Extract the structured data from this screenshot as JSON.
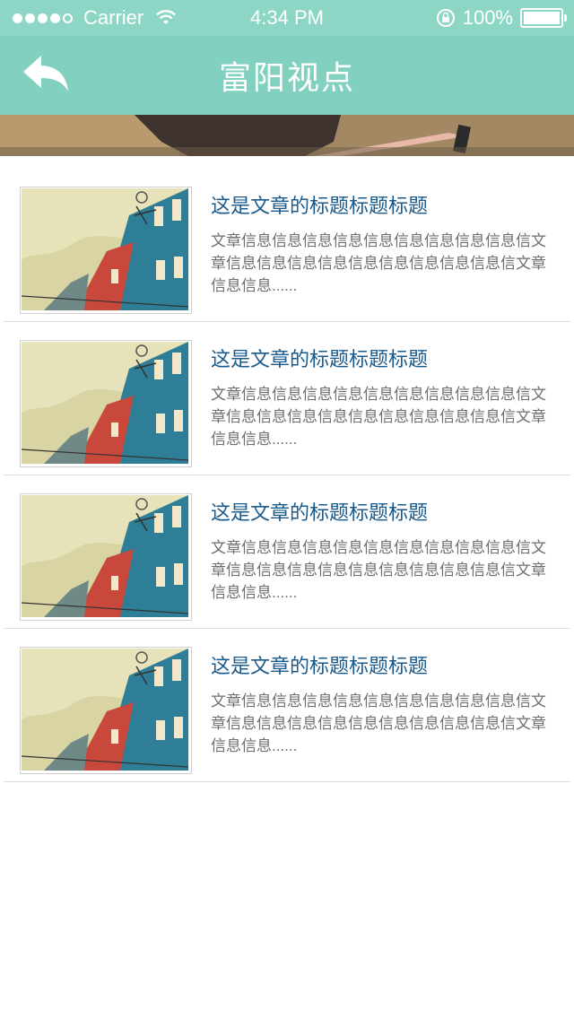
{
  "status_bar": {
    "carrier": "Carrier",
    "time": "4:34 PM",
    "battery_percent_label": "100%",
    "battery_level": 1.0
  },
  "nav": {
    "title": "富阳视点",
    "back_icon": "reply-arrow-icon",
    "color": "#82d0bf"
  },
  "articles": [
    {
      "title": "这是文章的标题标题标题",
      "summary": "文章信息信息信息信息信息信息信息信息信息信文章信息信息信息信息信息信息信息信息信息信文章信息信息......"
    },
    {
      "title": "这是文章的标题标题标题",
      "summary": "文章信息信息信息信息信息信息信息信息信息信文章信息信息信息信息信息信息信息信息信息信文章信息信息......"
    },
    {
      "title": "这是文章的标题标题标题",
      "summary": "文章信息信息信息信息信息信息信息信息信息信文章信息信息信息信息信息信息信息信息信息信文章信息信息......"
    },
    {
      "title": "这是文章的标题标题标题",
      "summary": "文章信息信息信息信息信息信息信息信息信息信文章信息信息信息信息信息信息信息信息信息信文章信息信息......"
    }
  ],
  "colors": {
    "title_text": "#1b5b8c",
    "summary_text": "#6e6e6e",
    "status_bar": "#8dd6c6"
  }
}
